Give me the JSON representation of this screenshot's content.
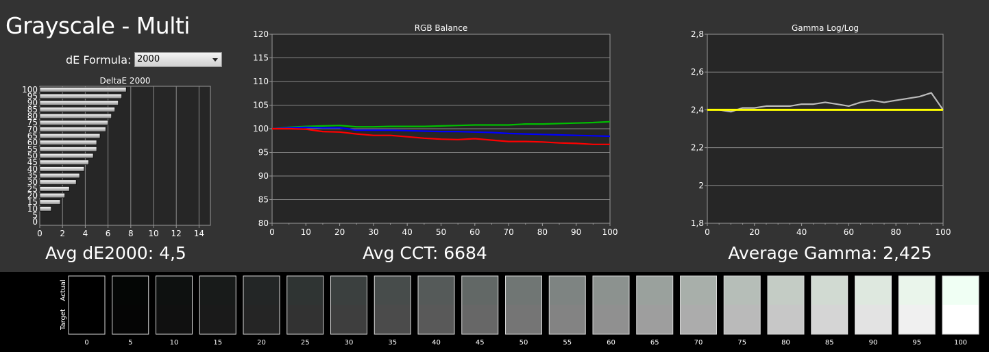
{
  "page": {
    "title": "Grayscale - Multi"
  },
  "formula": {
    "label": "dE Formula:",
    "value": "2000"
  },
  "summary": {
    "avg_de": "Avg dE2000: 4,5",
    "avg_cct": "Avg CCT: 6684",
    "avg_gamma": "Average Gamma: 2,425"
  },
  "colors": {
    "red": "#ff0000",
    "green": "#00c000",
    "blue": "#0000ff",
    "gamma": "#bbbbbb",
    "target": "#ffff00"
  },
  "chart_data": [
    {
      "type": "bar",
      "orientation": "horizontal",
      "title": "DeltaE 2000",
      "categories": [
        "100",
        "95",
        "90",
        "85",
        "80",
        "75",
        "70",
        "65",
        "60",
        "55",
        "50",
        "45",
        "40",
        "35",
        "30",
        "25",
        "20",
        "15",
        "10",
        "5",
        "0"
      ],
      "category_labels": [
        "100",
        "95",
        "90",
        "85",
        "80",
        "75",
        "70",
        "65",
        "60",
        "55",
        "50",
        "45",
        "40",
        "35",
        "30",
        "25",
        "20",
        "15",
        "10",
        "5",
        "0"
      ],
      "values": [
        7.6,
        7.2,
        6.9,
        6.6,
        6.3,
        6.0,
        5.8,
        5.3,
        5.0,
        5.0,
        4.7,
        4.3,
        3.9,
        3.5,
        3.2,
        2.6,
        2.2,
        1.8,
        1.0,
        0,
        0
      ],
      "xlim": [
        0,
        15
      ],
      "xticks": [
        "0",
        "2",
        "4",
        "6",
        "8",
        "10",
        "12",
        "14"
      ]
    },
    {
      "type": "line",
      "title": "RGB Balance",
      "x": [
        0,
        5,
        10,
        15,
        20,
        25,
        30,
        35,
        40,
        45,
        50,
        55,
        60,
        65,
        70,
        75,
        80,
        85,
        90,
        95,
        100
      ],
      "series": [
        {
          "color": "#00c000",
          "values": [
            100,
            100.3,
            100.5,
            100.6,
            100.7,
            100.4,
            100.4,
            100.5,
            100.5,
            100.5,
            100.6,
            100.7,
            100.8,
            100.8,
            100.8,
            101.0,
            101.0,
            101.1,
            101.2,
            101.3,
            101.5
          ]
        },
        {
          "color": "#0000ff",
          "values": [
            100,
            100.2,
            100.3,
            100.2,
            100.2,
            99.7,
            99.7,
            99.7,
            99.6,
            99.5,
            99.4,
            99.4,
            99.3,
            99.2,
            99.0,
            98.9,
            98.8,
            98.7,
            98.6,
            98.5,
            98.4
          ]
        },
        {
          "color": "#ff0000",
          "values": [
            100,
            100.0,
            99.9,
            99.4,
            99.3,
            98.9,
            98.6,
            98.6,
            98.3,
            98.0,
            97.8,
            97.7,
            97.9,
            97.6,
            97.3,
            97.3,
            97.2,
            97.0,
            96.9,
            96.7,
            96.7
          ]
        }
      ],
      "ylim": [
        80,
        120
      ],
      "yticks": [
        "120",
        "115",
        "110",
        "105",
        "100",
        "95",
        "90",
        "85",
        "80"
      ],
      "xticks": [
        "0",
        "10",
        "20",
        "30",
        "40",
        "50",
        "60",
        "70",
        "80",
        "90",
        "100"
      ]
    },
    {
      "type": "line",
      "title": "Gamma Log/Log",
      "x": [
        0,
        5,
        10,
        15,
        20,
        25,
        30,
        35,
        40,
        45,
        50,
        55,
        60,
        65,
        70,
        75,
        80,
        85,
        90,
        95,
        100
      ],
      "series": [
        {
          "color": "#bbbbbb",
          "values": [
            2.4,
            2.4,
            2.39,
            2.41,
            2.41,
            2.42,
            2.42,
            2.42,
            2.43,
            2.43,
            2.44,
            2.43,
            2.42,
            2.44,
            2.45,
            2.44,
            2.45,
            2.46,
            2.47,
            2.49,
            2.4
          ]
        },
        {
          "color": "#ffff00",
          "values": [
            2.4,
            2.4,
            2.4,
            2.4,
            2.4,
            2.4,
            2.4,
            2.4,
            2.4,
            2.4,
            2.4,
            2.4,
            2.4,
            2.4,
            2.4,
            2.4,
            2.4,
            2.4,
            2.4,
            2.4,
            2.4
          ]
        }
      ],
      "ylim": [
        1.8,
        2.8
      ],
      "yticks": [
        "2,8",
        "2,6",
        "2,4",
        "2,2",
        "2",
        "1,8"
      ],
      "xticks": [
        "0",
        "20",
        "40",
        "60",
        "80",
        "100"
      ]
    }
  ],
  "swatches": {
    "row_labels": [
      "Actual",
      "Target"
    ],
    "items": [
      {
        "label": "0",
        "actual": "#000000",
        "target": "#000000"
      },
      {
        "label": "5",
        "actual": "#040605",
        "target": "#050505"
      },
      {
        "label": "10",
        "actual": "#0e1110",
        "target": "#101010"
      },
      {
        "label": "15",
        "actual": "#181b1a",
        "target": "#1a1a1a"
      },
      {
        "label": "20",
        "actual": "#232626",
        "target": "#252525"
      },
      {
        "label": "25",
        "actual": "#2f3433",
        "target": "#323232"
      },
      {
        "label": "30",
        "actual": "#3b403f",
        "target": "#3e3e3e"
      },
      {
        "label": "35",
        "actual": "#474c4b",
        "target": "#4b4b4b"
      },
      {
        "label": "40",
        "actual": "#555a59",
        "target": "#595959"
      },
      {
        "label": "45",
        "actual": "#626866",
        "target": "#676767"
      },
      {
        "label": "50",
        "actual": "#707674",
        "target": "#757575"
      },
      {
        "label": "55",
        "actual": "#7e8482",
        "target": "#838383"
      },
      {
        "label": "60",
        "actual": "#8c928f",
        "target": "#909090"
      },
      {
        "label": "65",
        "actual": "#9aa19d",
        "target": "#9e9e9e"
      },
      {
        "label": "70",
        "actual": "#a8afaa",
        "target": "#acacac"
      },
      {
        "label": "75",
        "actual": "#b6beb8",
        "target": "#bababa"
      },
      {
        "label": "80",
        "actual": "#c4ccc5",
        "target": "#c7c7c7"
      },
      {
        "label": "85",
        "actual": "#d1dad2",
        "target": "#d5d5d5"
      },
      {
        "label": "90",
        "actual": "#dee8df",
        "target": "#e3e3e3"
      },
      {
        "label": "95",
        "actual": "#eaf5eb",
        "target": "#f0f0f0"
      },
      {
        "label": "100",
        "actual": "#f0fff4",
        "target": "#ffffff"
      }
    ]
  }
}
